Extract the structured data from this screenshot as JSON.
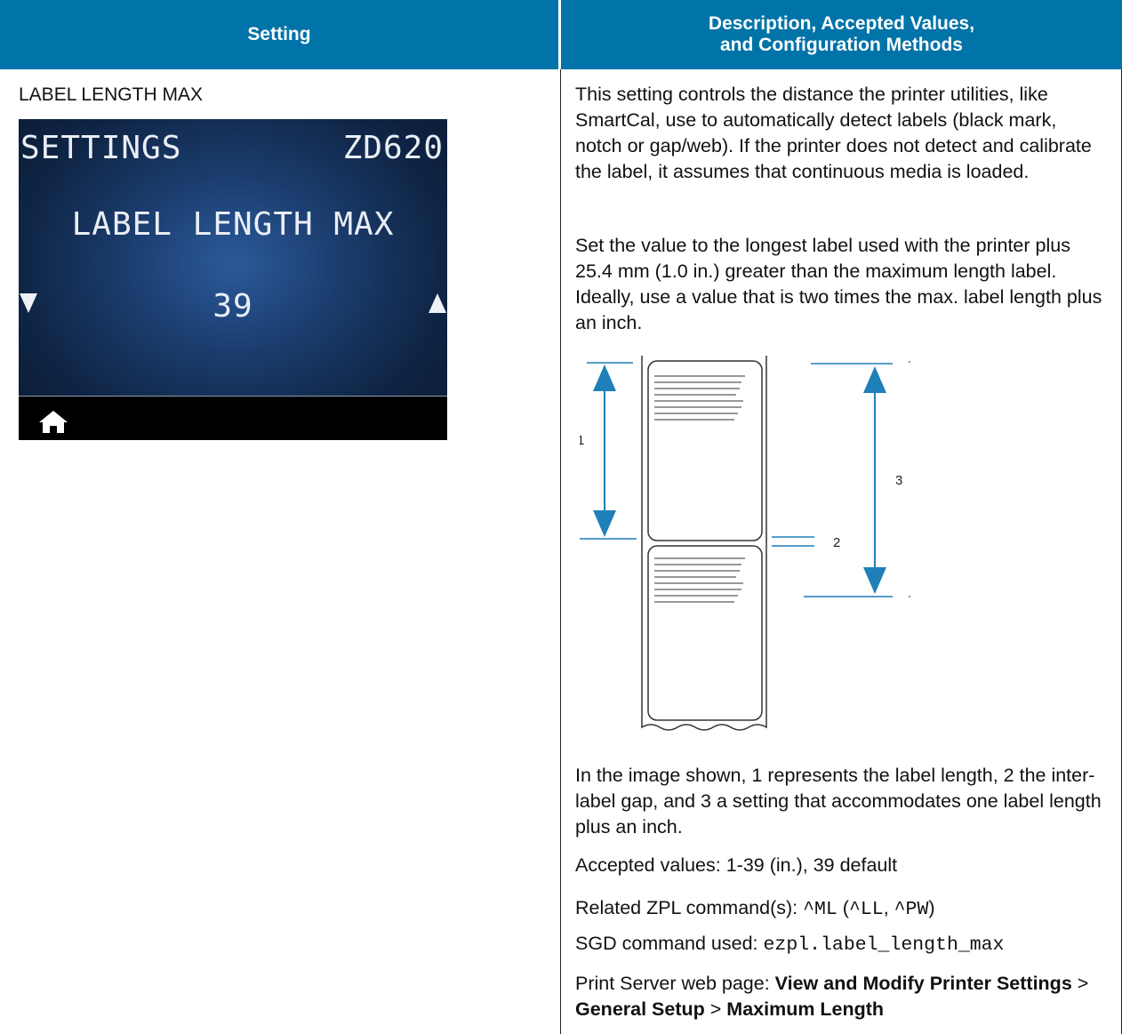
{
  "table": {
    "header_setting": "Setting",
    "header_desc_line1": "Description, Accepted Values,",
    "header_desc_line2": "and Configuration Methods",
    "header_color": "#0073a8"
  },
  "setting": {
    "name": "LABEL LENGTH MAX",
    "lcd": {
      "header_left": "SETTINGS",
      "header_right": "ZD620",
      "title": "LABEL LENGTH MAX",
      "value": "39",
      "down_icon": "triangle-down-icon",
      "up_icon": "triangle-up-icon",
      "home_icon": "home-icon"
    }
  },
  "description": {
    "p1": "This setting controls the distance the printer utilities, like SmartCal, use to automatically detect labels (black mark, notch or gap/web). If the printer does not detect and calibrate the label, it assumes that continuous media is loaded.",
    "p2": "Set the value to the longest label used with the printer plus 25.4 mm (1.0 in.) greater than the maximum length label. Ideally, use a value that is two times the max. label length plus an inch.",
    "figure": {
      "callout_1": "1",
      "callout_2": "2",
      "callout_3": "3",
      "arrow_color": "#1f7fb8"
    },
    "p3": "In the image shown, 1 represents the label length, 2 the inter-label gap, and 3 a setting that accommodates one label length plus an inch.",
    "accepted": "Accepted values: 1-39 (in.), 39 default",
    "zpl_prefix": "Related ZPL command(s): ",
    "zpl_cmd1": "^ML",
    "zpl_open": " (",
    "zpl_cmd2": "^LL",
    "zpl_sep": ", ",
    "zpl_cmd3": "^PW",
    "zpl_close": ")",
    "sgd_prefix": "SGD command used: ",
    "sgd_cmd": "ezpl.label_length_max",
    "ps_prefix": "Print Server web page: ",
    "ps_part1": "View and Modify Printer Settings",
    "ps_sep1": " > ",
    "ps_part2": "General Setup",
    "ps_sep2": " > ",
    "ps_part3": "Maximum Length"
  }
}
